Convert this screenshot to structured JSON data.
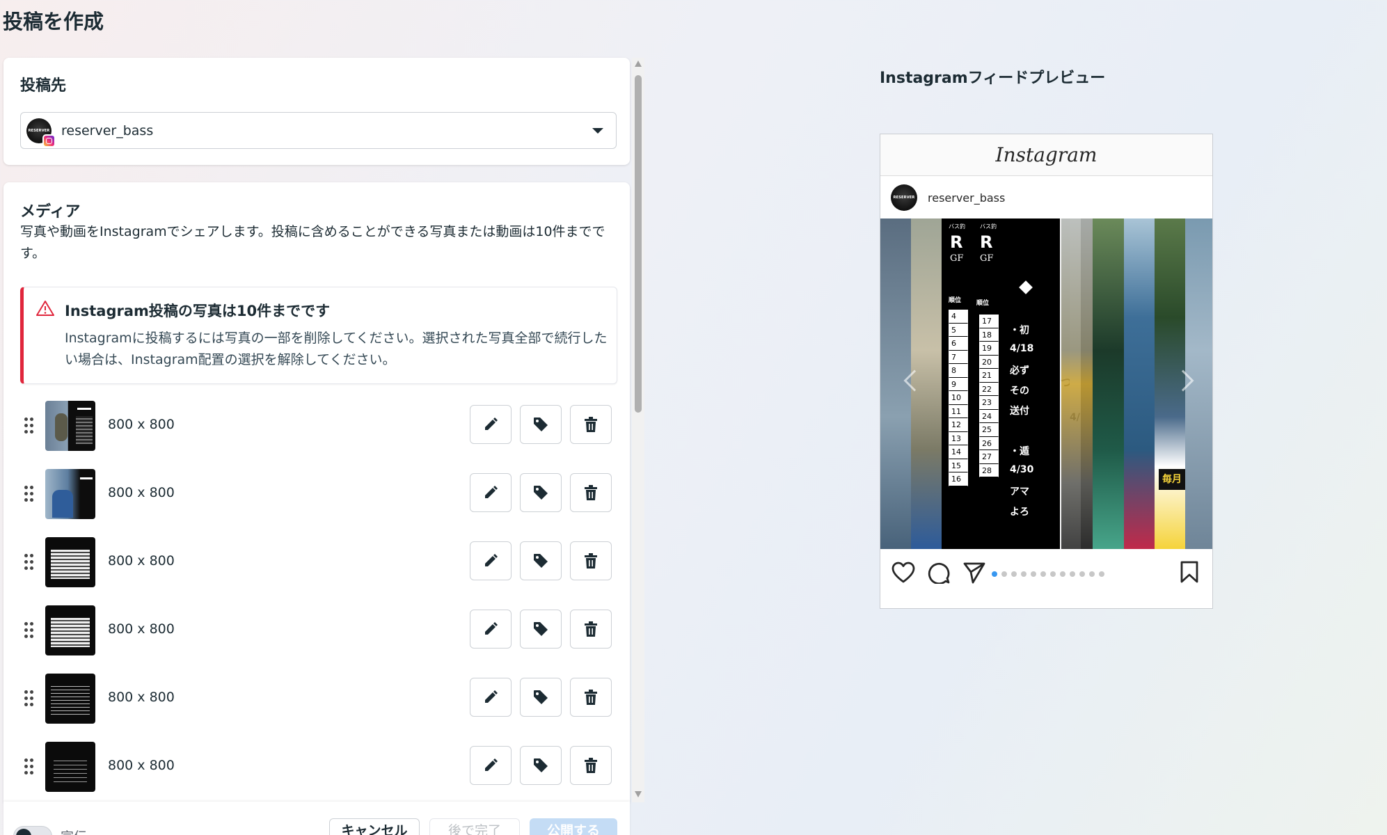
{
  "page": {
    "title": "投稿を作成"
  },
  "destination": {
    "title": "投稿先",
    "account_name": "reserver_bass",
    "avatar_text": "RESERVER"
  },
  "media": {
    "title": "メディア",
    "description": "写真や動画をInstagramでシェアします。投稿に含めることができる写真または動画は10件までです。",
    "alert": {
      "title": "Instagram投稿の写真は10件までです",
      "body": "Instagramに投稿するには写真の一部を削除してください。選択された写真全部で続行したい場合は、Instagram配置の選択を解除してください。"
    },
    "items": [
      {
        "size": "800 x 800"
      },
      {
        "size": "800 x 800"
      },
      {
        "size": "800 x 800"
      },
      {
        "size": "800 x 800"
      },
      {
        "size": "800 x 800"
      },
      {
        "size": "800 x 800"
      }
    ]
  },
  "footer": {
    "toggle_label": "宣伝",
    "cancel_label": "キャンセル",
    "later_label": "後で完了",
    "publish_label": "公開する"
  },
  "preview": {
    "title": "Instagramフィードプレビュー",
    "logo": "Instagram",
    "account_name": "reserver_bass",
    "image_text": {
      "col1_head": "バス釣",
      "col2_head": "バス釣",
      "col1_letter": "R",
      "col2_letter": "R",
      "col1_sub": "GF",
      "col2_sub": "GF",
      "rank_label": "順位",
      "col1_ranks": [
        "4",
        "5",
        "6",
        "7",
        "8",
        "9",
        "10",
        "11",
        "12",
        "13",
        "14",
        "15",
        "16"
      ],
      "col2_ranks": [
        "17",
        "18",
        "19",
        "20",
        "21",
        "22",
        "23",
        "24",
        "25",
        "26",
        "27",
        "28"
      ],
      "notes": [
        "・初",
        "4/18",
        "必ず",
        "その",
        "送付",
        "",
        "・遁",
        "4/30",
        "アマ",
        "よろ"
      ],
      "side_char": "つ",
      "side_num": "4/",
      "badge": "毎月"
    },
    "carousel_dots": 12,
    "active_dot": 0
  },
  "colors": {
    "alert_border": "#e0263c",
    "active_dot": "#3897f0",
    "publish_disabled": "#c4dcf5"
  }
}
